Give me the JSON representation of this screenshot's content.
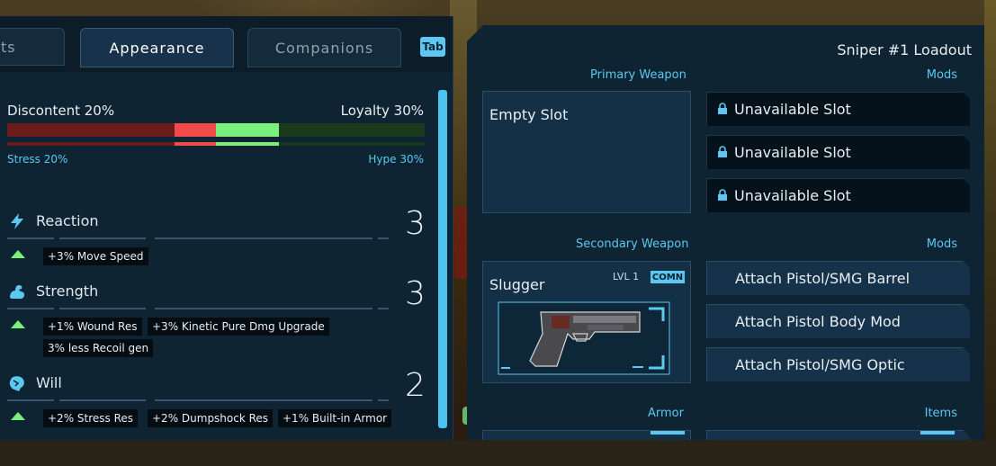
{
  "tabs": [
    {
      "label": "ts",
      "active": false
    },
    {
      "label": "Appearance",
      "active": true
    },
    {
      "label": "Companions",
      "active": false
    }
  ],
  "tab_key": "Tab",
  "morale": {
    "left_label": "Discontent 20%",
    "right_label": "Loyalty 30%",
    "stress_label": "Stress 20%",
    "hype_label": "Hype 30%",
    "discontent": 0.2,
    "loyalty": 0.3
  },
  "stats": [
    {
      "name": "Reaction",
      "value": "3",
      "icon": "lightning-icon",
      "bonuses": [
        "+3% Move Speed"
      ]
    },
    {
      "name": "Strength",
      "value": "3",
      "icon": "flexed-arm-icon",
      "bonuses": [
        "+1% Wound Res",
        "+3% Kinetic Pure Dmg Upgrade",
        "3% less Recoil gen"
      ]
    },
    {
      "name": "Will",
      "value": "2",
      "icon": "brain-icon",
      "bonuses": [
        "+2% Stress Res",
        "+2% Dumpshock Res",
        "+1% Built-in Armor"
      ]
    }
  ],
  "loadout": {
    "title": "Sniper #1 Loadout",
    "primary_label": "Primary Weapon",
    "mods_label": "Mods",
    "primary_slot": "Empty Slot",
    "primary_mods": [
      "Unavailable Slot",
      "Unavailable Slot",
      "Unavailable Slot"
    ],
    "secondary_label": "Secondary Weapon",
    "secondary_name": "Slugger",
    "secondary_level": "LVL 1",
    "secondary_rarity": "COMN",
    "secondary_mods": [
      "Attach Pistol/SMG Barrel",
      "Attach Pistol Body Mod",
      "Attach Pistol/SMG Optic"
    ],
    "armor_label": "Armor",
    "items_label": "Items"
  },
  "colors": {
    "accent": "#5ac8f0",
    "discontent_dark": "#6a1c1c",
    "discontent_bright": "#f24a4a",
    "loyalty_bright": "#7cf07c",
    "loyalty_dark": "#1a3a1c",
    "panel": "#0f2433"
  }
}
